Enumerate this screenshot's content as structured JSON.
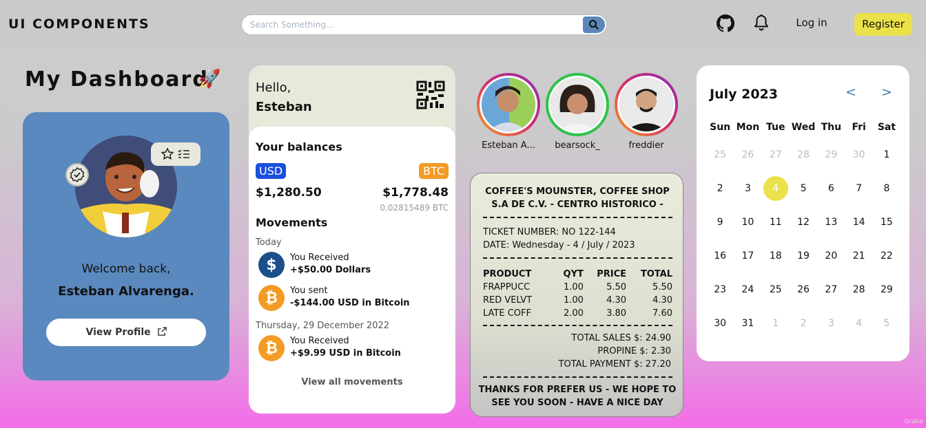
{
  "header": {
    "brand": "UI COMPONENTS",
    "search_placeholder": "Search Something...",
    "login": "Log in",
    "register": "Register",
    "accent_color": "#ebe14a"
  },
  "dashboard": {
    "title": "My Dashboard",
    "emoji": "🚀"
  },
  "profile": {
    "welcome": "Welcome back,",
    "name": "Esteban Alvarenga.",
    "button": "View Profile",
    "card_color": "#5a89bf"
  },
  "wallet": {
    "hello": "Hello,",
    "name": "Esteban",
    "balances_title": "Your balances",
    "usd_tag": "USD",
    "btc_tag": "BTC",
    "usd_amount": "$1,280.50",
    "btc_amount": "$1,778.48",
    "btc_units": "0.02815489 BTC",
    "movements_title": "Movements",
    "groups": [
      {
        "day": "Today"
      },
      {
        "day": "Thursday, 29 December 2022"
      }
    ],
    "movements": [
      {
        "icon": "dollar-icon",
        "l1": "You Received",
        "l2": "+$50.00 Dollars"
      },
      {
        "icon": "bitcoin-icon",
        "l1": "You sent",
        "l2": "-$144.00 USD in Bitcoin"
      },
      {
        "icon": "bitcoin-icon",
        "l1": "You Received",
        "l2": "+$9.99 USD in Bitcoin"
      }
    ],
    "view_all": "View all movements"
  },
  "stories": [
    {
      "name": "Esteban A..."
    },
    {
      "name": "bearsock_"
    },
    {
      "name": "freddier"
    }
  ],
  "receipt": {
    "head1": "COFFEE'S MOUNSTER, COFFEE SHOP",
    "head2": "S.A DE C.V. - CENTRO HISTORICO -",
    "ticket": "TICKET NUMBER: NO 122-144",
    "date": "DATE: Wednesday - 4 / July / 2023",
    "columns": [
      "PRODUCT",
      "QYT",
      "PRICE",
      "TOTAL"
    ],
    "rows": [
      [
        "FRAPPUCC",
        "1.00",
        "5.50",
        "5.50"
      ],
      [
        "RED VELVT",
        "1.00",
        "4.30",
        "4.30"
      ],
      [
        "LATE COFF",
        "2.00",
        "3.80",
        "7.60"
      ]
    ],
    "total_sales": "TOTAL SALES $: 24.90",
    "propine": "PROPINE $: 2.30",
    "total_payment": "TOTAL PAYMENT $: 27.20",
    "foot1": "THANKS FOR PREFER US - WE HOPE TO",
    "foot2": "SEE YOU SOON - HAVE A NICE DAY"
  },
  "calendar": {
    "month": "July 2023",
    "prev": "<",
    "next": ">",
    "weekdays": [
      "Sun",
      "Mon",
      "Tue",
      "Wed",
      "Thu",
      "Fri",
      "Sat"
    ],
    "weeks": [
      [
        "25",
        "26",
        "27",
        "28",
        "29",
        "30",
        "1"
      ],
      [
        "2",
        "3",
        "4",
        "5",
        "6",
        "7",
        "8"
      ],
      [
        "9",
        "10",
        "11",
        "12",
        "13",
        "14",
        "15"
      ],
      [
        "16",
        "17",
        "18",
        "19",
        "20",
        "21",
        "22"
      ],
      [
        "23",
        "24",
        "25",
        "26",
        "27",
        "28",
        "29"
      ],
      [
        "30",
        "31",
        "1",
        "2",
        "3",
        "4",
        "5"
      ]
    ],
    "today": "4"
  }
}
